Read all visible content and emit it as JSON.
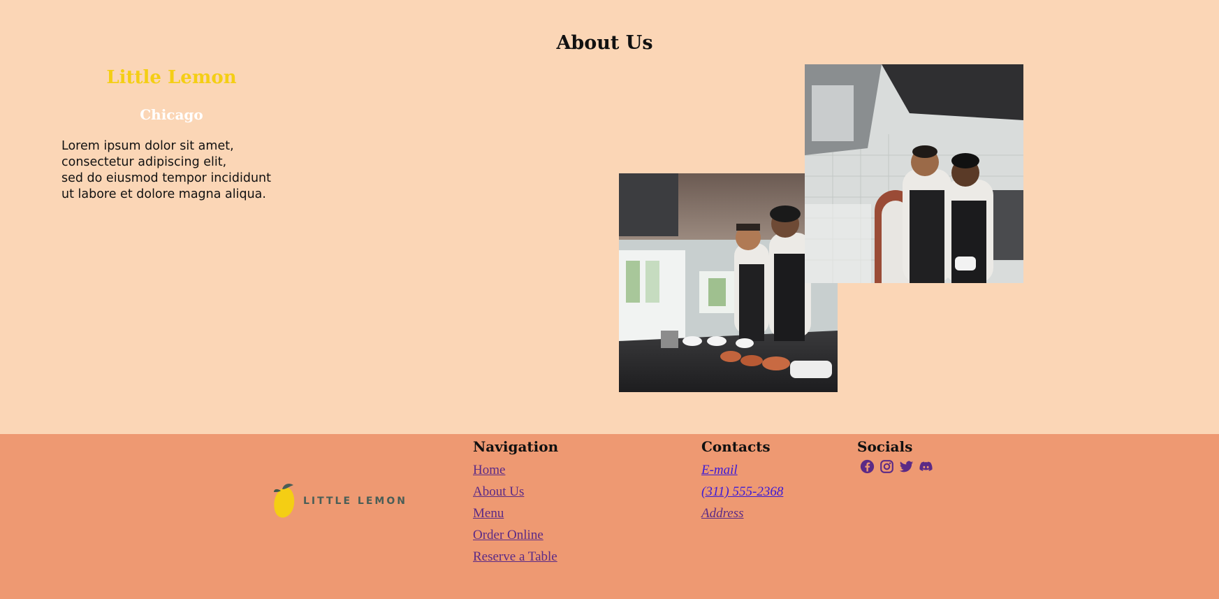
{
  "about": {
    "title": "About Us",
    "brand": "Little Lemon",
    "city": "Chicago",
    "lines": [
      "Lorem ipsum dolor sit amet,",
      "consectetur adipiscing elit,",
      "sed do eiusmod tempor incididunt",
      "ut labore et dolore magna aliqua."
    ]
  },
  "footer": {
    "logo_text": "LITTLE LEMON",
    "navigation": {
      "heading": "Navigation",
      "links": [
        "Home",
        "About Us",
        "Menu",
        "Order Online",
        "Reserve a Table"
      ]
    },
    "contacts": {
      "heading": "Contacts",
      "links": [
        "E-mail",
        "(311) 555-2368",
        "Address"
      ]
    },
    "socials": {
      "heading": "Socials",
      "icons": [
        "facebook-icon",
        "instagram-icon",
        "twitter-icon",
        "discord-icon"
      ]
    }
  },
  "colors": {
    "page_bg": "#fbd6b6",
    "footer_bg": "#ee9972",
    "brand_yellow": "#f4ce14",
    "brand_green": "#495e57",
    "link_purple": "#5b2a86",
    "link_blue": "#3b1ad6"
  }
}
